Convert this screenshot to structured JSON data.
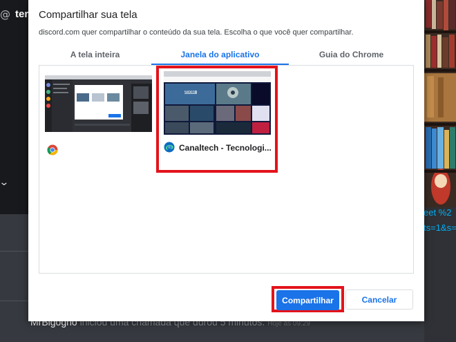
{
  "background": {
    "at_symbol": "@",
    "channel_fragment": "ter",
    "chevron": "❯",
    "link_line1": "eet %2",
    "link_line2": "ts=1&s=",
    "message": {
      "author": "MrBigogho",
      "text": " iniciou uma chamada que durou 5 minutos.",
      "timestamp": "Hoje às 09:29"
    }
  },
  "dialog": {
    "title": "Compartilhar sua tela",
    "description": "discord.com quer compartilhar o conteúdo da sua tela. Escolha o que você quer compartilhar.",
    "tabs": [
      {
        "label": "A tela inteira",
        "active": false
      },
      {
        "label": "Janela do aplicativo",
        "active": true
      },
      {
        "label": "Guia do Chrome",
        "active": false
      }
    ],
    "windows": [
      {
        "label": "",
        "icon": "chrome-icon"
      },
      {
        "label": "Canaltech - Tecnologi...",
        "icon": "edge-icon",
        "thumbnail_text": "ZOOM"
      }
    ],
    "share_button": "Compartilhar",
    "cancel_button": "Cancelar"
  },
  "colors": {
    "accent": "#1a73e8",
    "highlight": "#e3131b",
    "discord_dark": "#36393f"
  }
}
